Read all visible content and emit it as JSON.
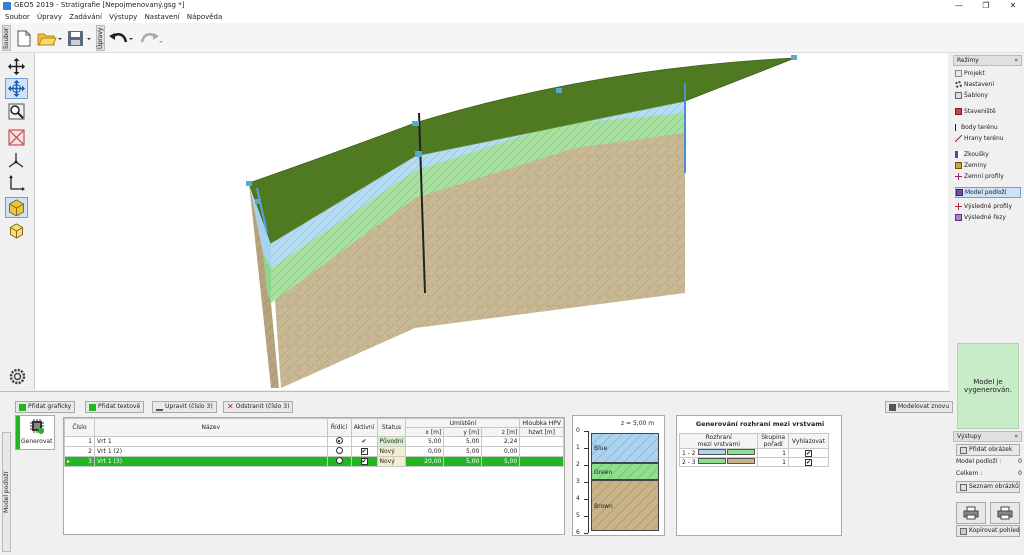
{
  "window": {
    "title": "GEO5 2019 - Stratigrafie [Nepojmenovaný.gsg *]",
    "minimize": "—",
    "maximize": "❐",
    "close": "✕"
  },
  "menu": [
    "Soubor",
    "Úpravy",
    "Zadávání",
    "Výstupy",
    "Nastavení",
    "Nápověda"
  ],
  "toolbar": {
    "group1_label": "Soubor",
    "group2_label": "Úpravy"
  },
  "right_panel": {
    "header": "Režimy",
    "items": [
      {
        "label": "Projekt",
        "icon": "project-icon"
      },
      {
        "label": "Nastavení",
        "icon": "gear-icon"
      },
      {
        "label": "Šablony",
        "icon": "template-icon"
      },
      {
        "label": "Staveniště",
        "icon": "site-icon"
      },
      {
        "label": "Body terénu",
        "icon": "terrain-point-icon"
      },
      {
        "label": "Hrany terénu",
        "icon": "terrain-edge-icon"
      },
      {
        "label": "Zkoušky",
        "icon": "borehole-icon"
      },
      {
        "label": "Zeminy",
        "icon": "soil-icon"
      },
      {
        "label": "Zemní profily",
        "icon": "profile-icon"
      },
      {
        "label": "Model podloží",
        "icon": "model-icon"
      },
      {
        "label": "Výsledné profily",
        "icon": "result-profile-icon"
      },
      {
        "label": "Výsledné řezy",
        "icon": "section-icon"
      }
    ],
    "status_message": "Model je vygenerován.",
    "outputs_header": "Výstupy",
    "add_image": "Přidat obrázek",
    "model_count_label": "Model podloží :",
    "model_count": "0",
    "total_label": "Celkem :",
    "total_count": "0",
    "image_list": "Seznam obrázků",
    "copy_view": "Kopírovat pohled"
  },
  "bottom": {
    "generate_label": "Generovat",
    "side_label": "Model podloží",
    "add_graphic": "Přidat graficky",
    "add_text": "Přidat textově",
    "edit": "Upravit (číslo 3)",
    "remove": "Odstranit (číslo 3)",
    "regen": "Modelovat znovu",
    "table_headers": {
      "number": "Číslo",
      "name": "Název",
      "control": "Řídící",
      "active": "Aktivní",
      "status": "Status",
      "location": "Umístění",
      "x": "x [m]",
      "y": "y [m]",
      "z": "z [m]",
      "depth": "Hloubka HPV",
      "depth_unit": "hzwt [m]"
    },
    "rows": [
      {
        "n": "1",
        "name": "Vrt 1",
        "status": "Původní",
        "x": "5,00",
        "y": "5,00",
        "z": "2,24",
        "control": true,
        "active": "tick"
      },
      {
        "n": "2",
        "name": "Vrt 1 (2)",
        "status": "Nový",
        "x": "0,00",
        "y": "5,00",
        "z": "0,00",
        "control": false,
        "active": "box"
      },
      {
        "n": "3",
        "name": "Vrt 1 (3)",
        "status": "Nový",
        "x": "20,00",
        "y": "5,00",
        "z": "5,00",
        "control": false,
        "active": "box",
        "selected": true,
        "marker": "▸"
      }
    ],
    "profile": {
      "z_label": "z = 5,00 m",
      "ticks": [
        "0",
        "1",
        "2",
        "3",
        "4",
        "5",
        "6"
      ],
      "layers": [
        {
          "name": "Blue",
          "color": "#a9d3f0",
          "from": 0.1,
          "to": 1.9
        },
        {
          "name": "Green",
          "color": "#8ee08e",
          "from": 1.9,
          "to": 2.9
        },
        {
          "name": "Brown",
          "color": "#c9b48a",
          "from": 2.9,
          "to": 5.9
        }
      ]
    },
    "interfaces": {
      "title": "Generování rozhraní mezi vrstvami",
      "col_interface": "Rozhraní",
      "col_interface_sub": "mezi vrstvami",
      "col_group": "Skupina",
      "col_group_sub": "pořadí",
      "col_smooth": "Vyhlazovat",
      "rows": [
        {
          "label": "1 - 2",
          "c1": "#a9d3f0",
          "c2": "#8ee08e",
          "group": "1"
        },
        {
          "label": "2 - 3",
          "c1": "#8ee08e",
          "c2": "#c9b48a",
          "group": "1"
        }
      ]
    }
  }
}
